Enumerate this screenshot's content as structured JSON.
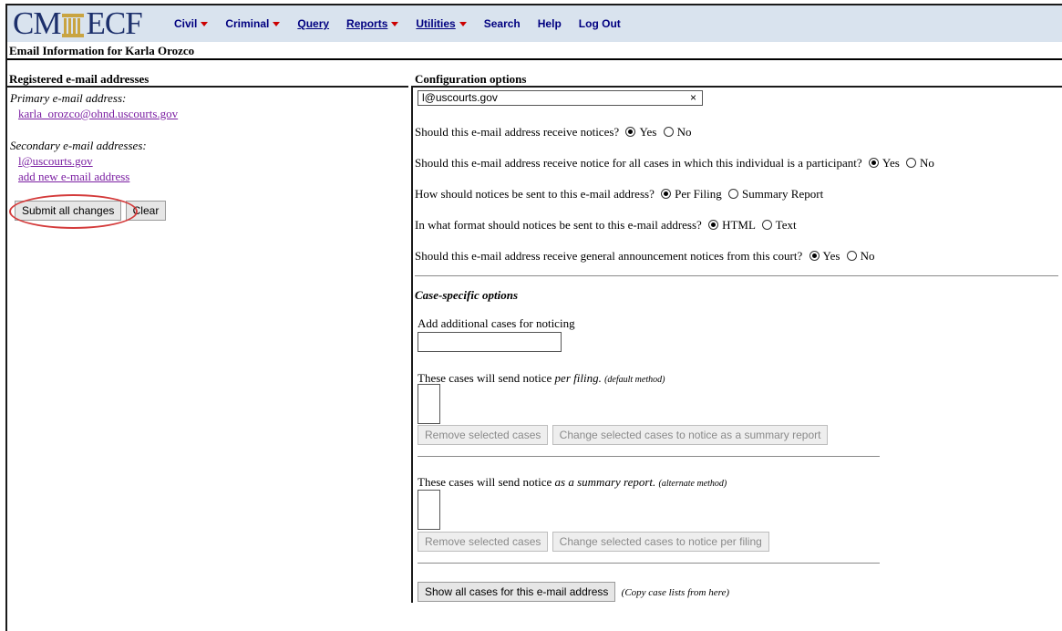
{
  "nav": {
    "logo_left": "CM",
    "logo_right": "ECF",
    "menu": [
      {
        "label": "Civil",
        "dropdown": true
      },
      {
        "label": "Criminal",
        "dropdown": true
      },
      {
        "label": "Query",
        "dropdown": false
      },
      {
        "label": "Reports",
        "dropdown": true
      },
      {
        "label": "Utilities",
        "dropdown": true
      },
      {
        "label": "Search",
        "dropdown": false
      },
      {
        "label": "Help",
        "dropdown": false
      },
      {
        "label": "Log Out",
        "dropdown": false
      }
    ]
  },
  "page_title": "Email Information for Karla Orozco",
  "left": {
    "heading": "Registered e-mail addresses",
    "primary_label": "Primary e-mail address:",
    "primary_email": "karla_orozco@ohnd.uscourts.gov",
    "secondary_label": "Secondary e-mail addresses:",
    "secondary_email": "l@uscourts.gov",
    "add_new": "add new e-mail address",
    "submit": "Submit all changes",
    "clear": "Clear"
  },
  "right": {
    "heading": "Configuration options",
    "email_value": "l@uscourts.gov",
    "email_clear": "×",
    "q1": "Should this e-mail address receive notices?",
    "q2": "Should this e-mail address receive notice for all cases in which this individual is a participant?",
    "q3": "How should notices be sent to this e-mail address?",
    "q4": "In what format should notices be sent to this e-mail address?",
    "q5": "Should this e-mail address receive general announcement notices from this court?",
    "yes": "Yes",
    "no": "No",
    "per_filing": "Per Filing",
    "summary_report": "Summary Report",
    "html": "HTML",
    "text": "Text",
    "case_specific": "Case-specific options",
    "add_cases": "Add additional cases for noticing",
    "per_filing_intro": "These cases will send notice",
    "per_filing_em": "per filing.",
    "default_method": "(default method)",
    "remove_1": "Remove selected cases",
    "change_to_summary": "Change selected cases to notice as a summary report",
    "summary_intro": "These cases will send notice",
    "summary_em": "as a summary report.",
    "alternate_method": "(alternate method)",
    "remove_2": "Remove selected cases",
    "change_to_per_filing": "Change selected cases to notice per filing",
    "show_all": "Show all cases for this e-mail address",
    "copy_note": "(Copy case lists from here)"
  },
  "colors": {
    "navbar_bg": "#d9e3ee",
    "menu_text": "#000080",
    "menu_caret": "#cc0000",
    "link": "#7b1fa2",
    "highlight": "#d43b3b"
  }
}
